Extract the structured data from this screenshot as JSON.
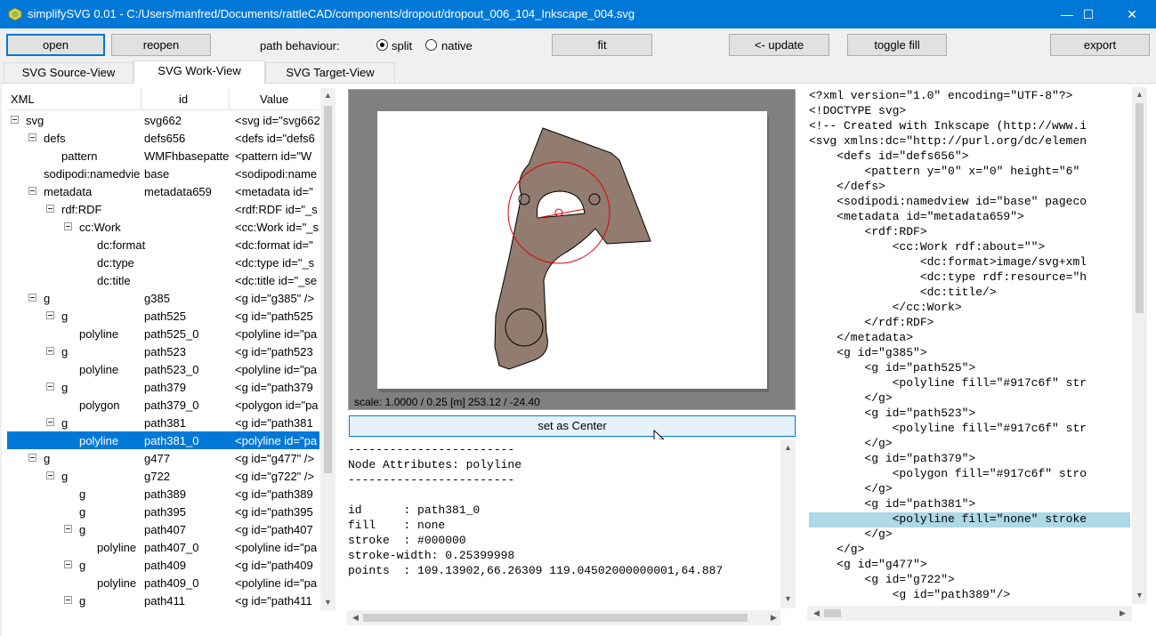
{
  "window": {
    "title": "simplifySVG 0.01 - C:/Users/manfred/Documents/rattleCAD/components/dropout/dropout_006_104_Inkscape_004.svg",
    "minimize": "—",
    "maximize": "☐",
    "close": "✕"
  },
  "toolbar": {
    "open": "open",
    "reopen": "reopen",
    "path_behaviour_label": "path behaviour:",
    "split": "split",
    "native": "native",
    "selected_mode": "split",
    "fit": "fit",
    "update": "<- update",
    "toggle_fill": "toggle fill",
    "export": "export"
  },
  "tabs": [
    "SVG Source-View",
    "SVG Work-View",
    "SVG Target-View"
  ],
  "active_tab": "SVG Work-View",
  "tree": {
    "headers": [
      "XML",
      "id",
      "Value"
    ],
    "rows": [
      {
        "name": "svg",
        "id": "svg662",
        "value": "<svg id=\"svg662\"",
        "expander": true
      },
      {
        "name": "defs",
        "id": "defs656",
        "value": "<defs id=\"defs6",
        "expander": true
      },
      {
        "name": "pattern",
        "id": "WMFhbasepatte",
        "value": "<pattern id=\"W",
        "expander": false
      },
      {
        "name": "sodipodi:namedvie",
        "id": "base",
        "value": "<sodipodi:name",
        "expander": false
      },
      {
        "name": "metadata",
        "id": "metadata659",
        "value": "<metadata id=\"",
        "expander": true
      },
      {
        "name": "rdf:RDF",
        "id": "",
        "value": "<rdf:RDF id=\"_s",
        "expander": true
      },
      {
        "name": "cc:Work",
        "id": "",
        "value": "<cc:Work id=\"_s",
        "expander": true
      },
      {
        "name": "dc:format",
        "id": "",
        "value": "<dc:format id=\"",
        "expander": false
      },
      {
        "name": "dc:type",
        "id": "",
        "value": "<dc:type id=\"_s",
        "expander": false
      },
      {
        "name": "dc:title",
        "id": "",
        "value": "<dc:title id=\"_se",
        "expander": false
      },
      {
        "name": "g",
        "id": "g385",
        "value": "<g id=\"g385\" />",
        "expander": true
      },
      {
        "name": "g",
        "id": "path525",
        "value": "<g id=\"path525",
        "expander": true
      },
      {
        "name": "polyline",
        "id": "path525_0",
        "value": "<polyline id=\"pa",
        "expander": false
      },
      {
        "name": "g",
        "id": "path523",
        "value": "<g id=\"path523",
        "expander": true
      },
      {
        "name": "polyline",
        "id": "path523_0",
        "value": "<polyline id=\"pa",
        "expander": false
      },
      {
        "name": "g",
        "id": "path379",
        "value": "<g id=\"path379",
        "expander": true
      },
      {
        "name": "polygon",
        "id": "path379_0",
        "value": "<polygon id=\"pa",
        "expander": false
      },
      {
        "name": "g",
        "id": "path381",
        "value": "<g id=\"path381",
        "expander": true
      },
      {
        "name": "polyline",
        "id": "path381_0",
        "value": "<polyline id=\"pa",
        "expander": false
      },
      {
        "name": "g",
        "id": "g477",
        "value": "<g id=\"g477\" />",
        "expander": true
      },
      {
        "name": "g",
        "id": "g722",
        "value": "<g id=\"g722\" />",
        "expander": true
      },
      {
        "name": "g",
        "id": "path389",
        "value": "<g id=\"path389",
        "expander": false
      },
      {
        "name": "g",
        "id": "path395",
        "value": "<g id=\"path395",
        "expander": false
      },
      {
        "name": "g",
        "id": "path407",
        "value": "<g id=\"path407",
        "expander": true
      },
      {
        "name": "polyline",
        "id": "path407_0",
        "value": "<polyline id=\"pa",
        "expander": false
      },
      {
        "name": "g",
        "id": "path409",
        "value": "<g id=\"path409",
        "expander": true
      },
      {
        "name": "polyline",
        "id": "path409_0",
        "value": "<polyline id=\"pa",
        "expander": false
      },
      {
        "name": "g",
        "id": "path411",
        "value": "<g id=\"path411",
        "expander": true
      }
    ],
    "selected_row": "path381_0"
  },
  "canvas": {
    "scale_text": "scale: 1.0000 / 0.25  [m]  253.12 / -24.40",
    "fill_color": "#917c6f",
    "highlight_color": "#e00000"
  },
  "center_button": "set as Center",
  "attributes": {
    "lines": [
      "------------------------",
      "Node Attributes: polyline",
      "------------------------",
      "",
      "id      : path381_0",
      "fill    : none",
      "stroke  : #000000",
      "stroke-width: 0.25399998",
      "points  : 109.13902,66.26309 119.04502000000001,64.887"
    ]
  },
  "code": {
    "lines": [
      "<?xml version=\"1.0\" encoding=\"UTF-8\"?>",
      "<!DOCTYPE svg>",
      "<!-- Created with Inkscape (http://www.i",
      "<svg xmlns:dc=\"http://purl.org/dc/elemen",
      "    <defs id=\"defs656\">",
      "        <pattern y=\"0\" x=\"0\" height=\"6\"",
      "    </defs>",
      "    <sodipodi:namedview id=\"base\" pageco",
      "    <metadata id=\"metadata659\">",
      "        <rdf:RDF>",
      "            <cc:Work rdf:about=\"\">",
      "                <dc:format>image/svg+xml",
      "                <dc:type rdf:resource=\"h",
      "                <dc:title/>",
      "            </cc:Work>",
      "        </rdf:RDF>",
      "    </metadata>",
      "    <g id=\"g385\">",
      "        <g id=\"path525\">",
      "            <polyline fill=\"#917c6f\" str",
      "        </g>",
      "        <g id=\"path523\">",
      "            <polyline fill=\"#917c6f\" str",
      "        </g>",
      "        <g id=\"path379\">",
      "            <polygon fill=\"#917c6f\" stro",
      "        </g>",
      "        <g id=\"path381\">",
      "            <polyline fill=\"none\" stroke",
      "        </g>",
      "    </g>",
      "    <g id=\"g477\">",
      "        <g id=\"g722\">",
      "            <g id=\"path389\"/>"
    ],
    "highlighted_line": 28
  }
}
